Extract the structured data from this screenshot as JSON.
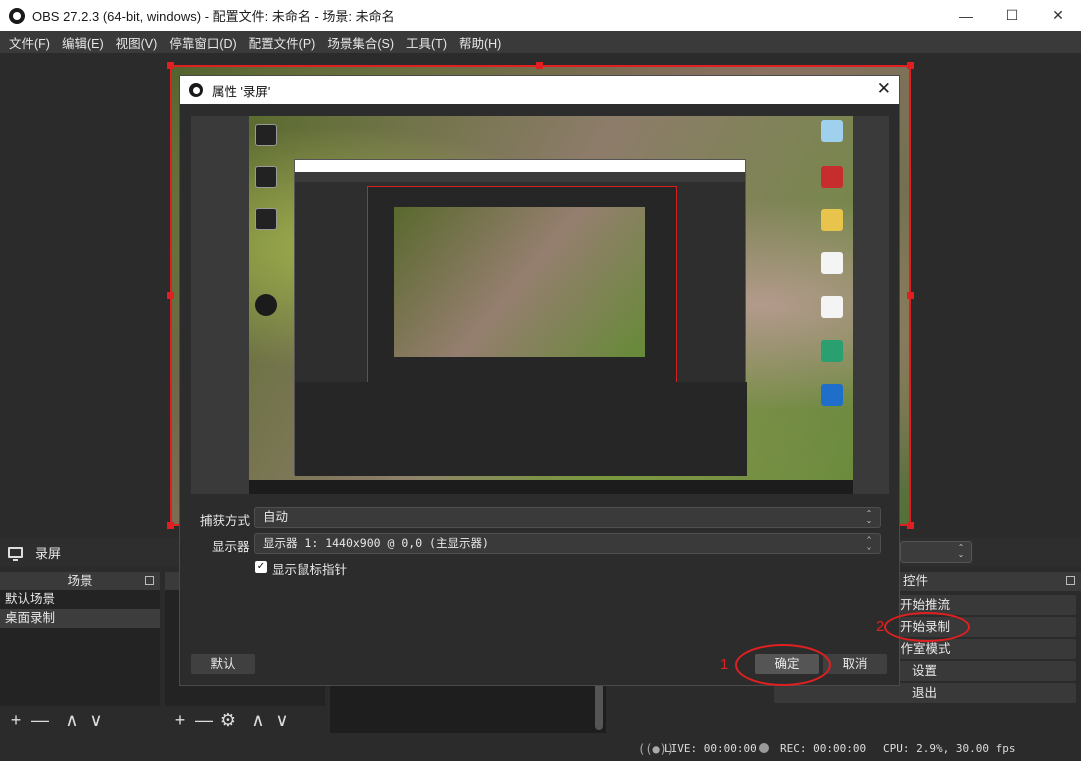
{
  "window": {
    "title": "OBS 27.2.3 (64-bit, windows) - 配置文件: 未命名 - 场景: 未命名",
    "minimize": "—",
    "maximize": "☐",
    "close": "✕"
  },
  "menu": [
    "文件(F)",
    "编辑(E)",
    "视图(V)",
    "停靠窗口(D)",
    "配置文件(P)",
    "场景集合(S)",
    "工具(T)",
    "帮助(H)"
  ],
  "source_bar": {
    "source_name": "录屏"
  },
  "scenes_dock": {
    "title": "场景",
    "items": [
      "默认场景",
      "桌面录制"
    ],
    "toolbar": [
      "+",
      "—",
      "∧",
      "∨"
    ]
  },
  "sources_dock": {
    "toolbar": [
      "+",
      "—",
      "⚙",
      "∧",
      "∨"
    ]
  },
  "controls_dock": {
    "title": "控件",
    "buttons": [
      "开始推流",
      "开始录制",
      "工作室模式",
      "设置",
      "退出"
    ]
  },
  "status_bar": {
    "live": "LIVE: 00:00:00",
    "rec": "REC: 00:00:00",
    "cpu": "CPU: 2.9%, 30.00 fps"
  },
  "dialog": {
    "title": "属性 '录屏'",
    "fields": {
      "capture_method_label": "捕获方式",
      "capture_method_value": "自动",
      "display_label": "显示器",
      "display_value": "显示器 1: 1440x900 @ 0,0 (主显示器)",
      "cursor_label": "显示鼠标指针",
      "cursor_checked": true
    },
    "buttons": {
      "defaults": "默认",
      "ok": "确定",
      "cancel": "取消"
    }
  },
  "annotations": [
    "1",
    "2"
  ],
  "colors": {
    "accent_red": "#e02020",
    "bg": "#2b2b2b"
  }
}
